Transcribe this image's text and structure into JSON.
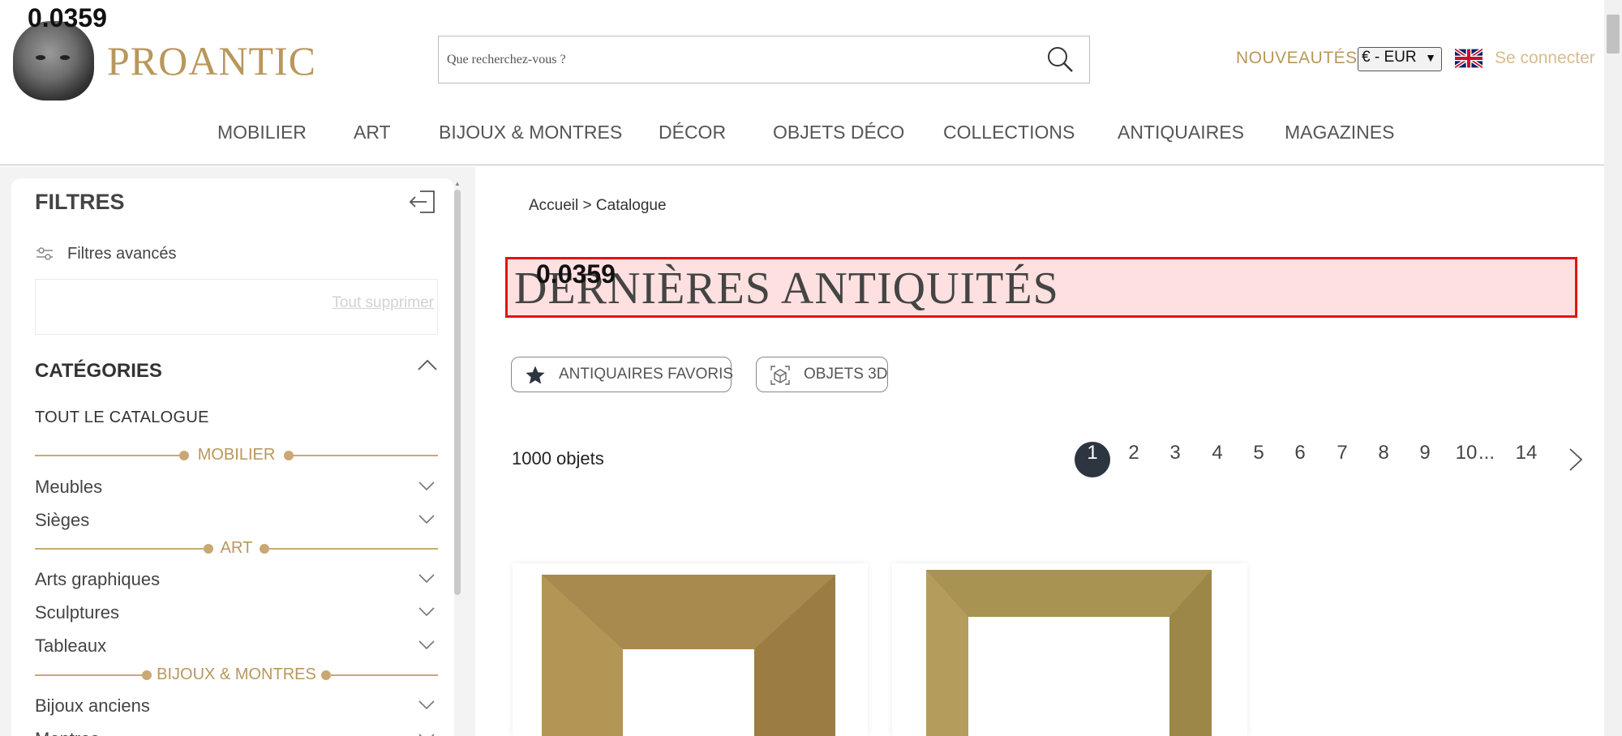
{
  "debug_label": "0.0359",
  "brand": {
    "name": "PROANTIC"
  },
  "search": {
    "placeholder": "Que recherchez-vous ?"
  },
  "header": {
    "new_label": "NOUVEAUTÉS",
    "currency": "€ - EUR",
    "login_label": "Se connecter"
  },
  "nav": {
    "items": [
      "MOBILIER",
      "ART",
      "BIJOUX & MONTRES",
      "DÉCOR",
      "OBJETS DÉCO",
      "COLLECTIONS",
      "ANTIQUAIRES",
      "MAGAZINES"
    ]
  },
  "sidebar": {
    "title": "FILTRES",
    "advanced_label": "Filtres avancés",
    "clear_all_label": "Tout supprimer",
    "categories_title": "CATÉGORIES",
    "all_catalog_label": "TOUT LE CATALOGUE",
    "sections": [
      {
        "label": "MOBILIER",
        "items": [
          "Meubles",
          "Sièges"
        ]
      },
      {
        "label": "ART",
        "items": [
          "Arts graphiques",
          "Sculptures",
          "Tableaux"
        ]
      },
      {
        "label": "BIJOUX & MONTRES",
        "items": [
          "Bijoux anciens",
          "Montres"
        ]
      }
    ]
  },
  "breadcrumb": "Accueil > Catalogue",
  "page_title": "DERNIÈRES ANTIQUITÉS",
  "chips": [
    "ANTIQUAIRES FAVORIS",
    "OBJETS 3D"
  ],
  "results": {
    "count_label": "1000 objets"
  },
  "pagination": {
    "pages": [
      "1",
      "2",
      "3",
      "4",
      "5",
      "6",
      "7",
      "8",
      "9",
      "10"
    ],
    "ellipsis": "...",
    "last": "14",
    "current": "1"
  },
  "colors": {
    "brand_gold": "#b9975b",
    "pagination_active": "#2d3541",
    "highlight_border": "#e01414"
  }
}
